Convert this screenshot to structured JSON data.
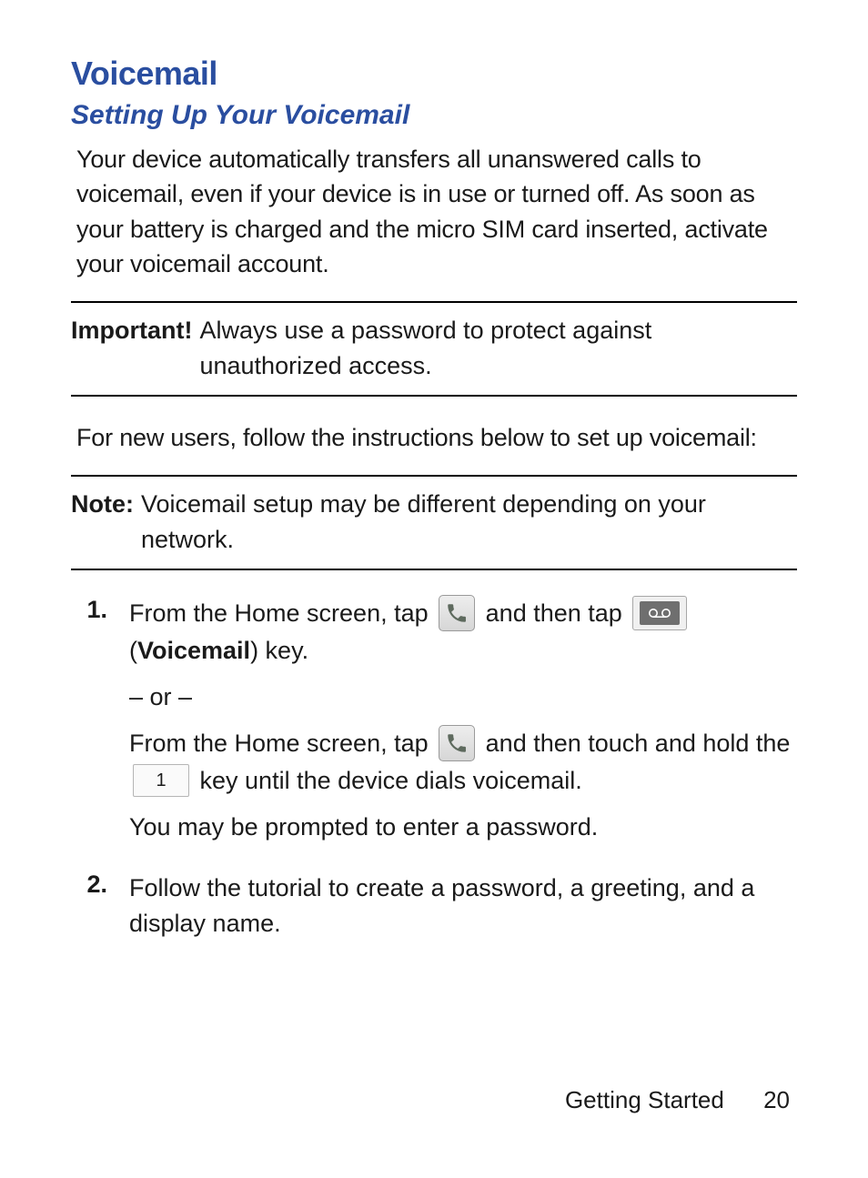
{
  "headings": {
    "h1": "Voicemail",
    "h2": "Setting Up Your Voicemail"
  },
  "intro": "Your device automatically transfers all unanswered calls to voicemail, even if your device is in use or turned off. As soon as your battery is charged and the micro SIM card inserted, activate your voicemail account.",
  "important": {
    "label": "Important!",
    "text": "Always use a password to protect against unauthorized access."
  },
  "for_new_users": "For new users, follow the instructions below to set up voicemail:",
  "note": {
    "label": "Note:",
    "text": "Voicemail setup may be different depending on your network."
  },
  "steps": {
    "s1": {
      "num": "1.",
      "line1_a": "From the Home screen, tap ",
      "line1_b": " and then tap ",
      "vm_label_open": " (",
      "vm_label_word": "Voicemail",
      "vm_label_close": ") key.",
      "or": "– or –",
      "line2_a": "From the Home screen, tap ",
      "line2_b": " and then touch and hold the ",
      "key1": "1",
      "line2_c": " key until the device dials voicemail.",
      "prompt": "You may be prompted to enter a password."
    },
    "s2": {
      "num": "2.",
      "text": "Follow the tutorial to create a password, a greeting, and a display name."
    }
  },
  "footer": {
    "section": "Getting Started",
    "page": "20"
  }
}
